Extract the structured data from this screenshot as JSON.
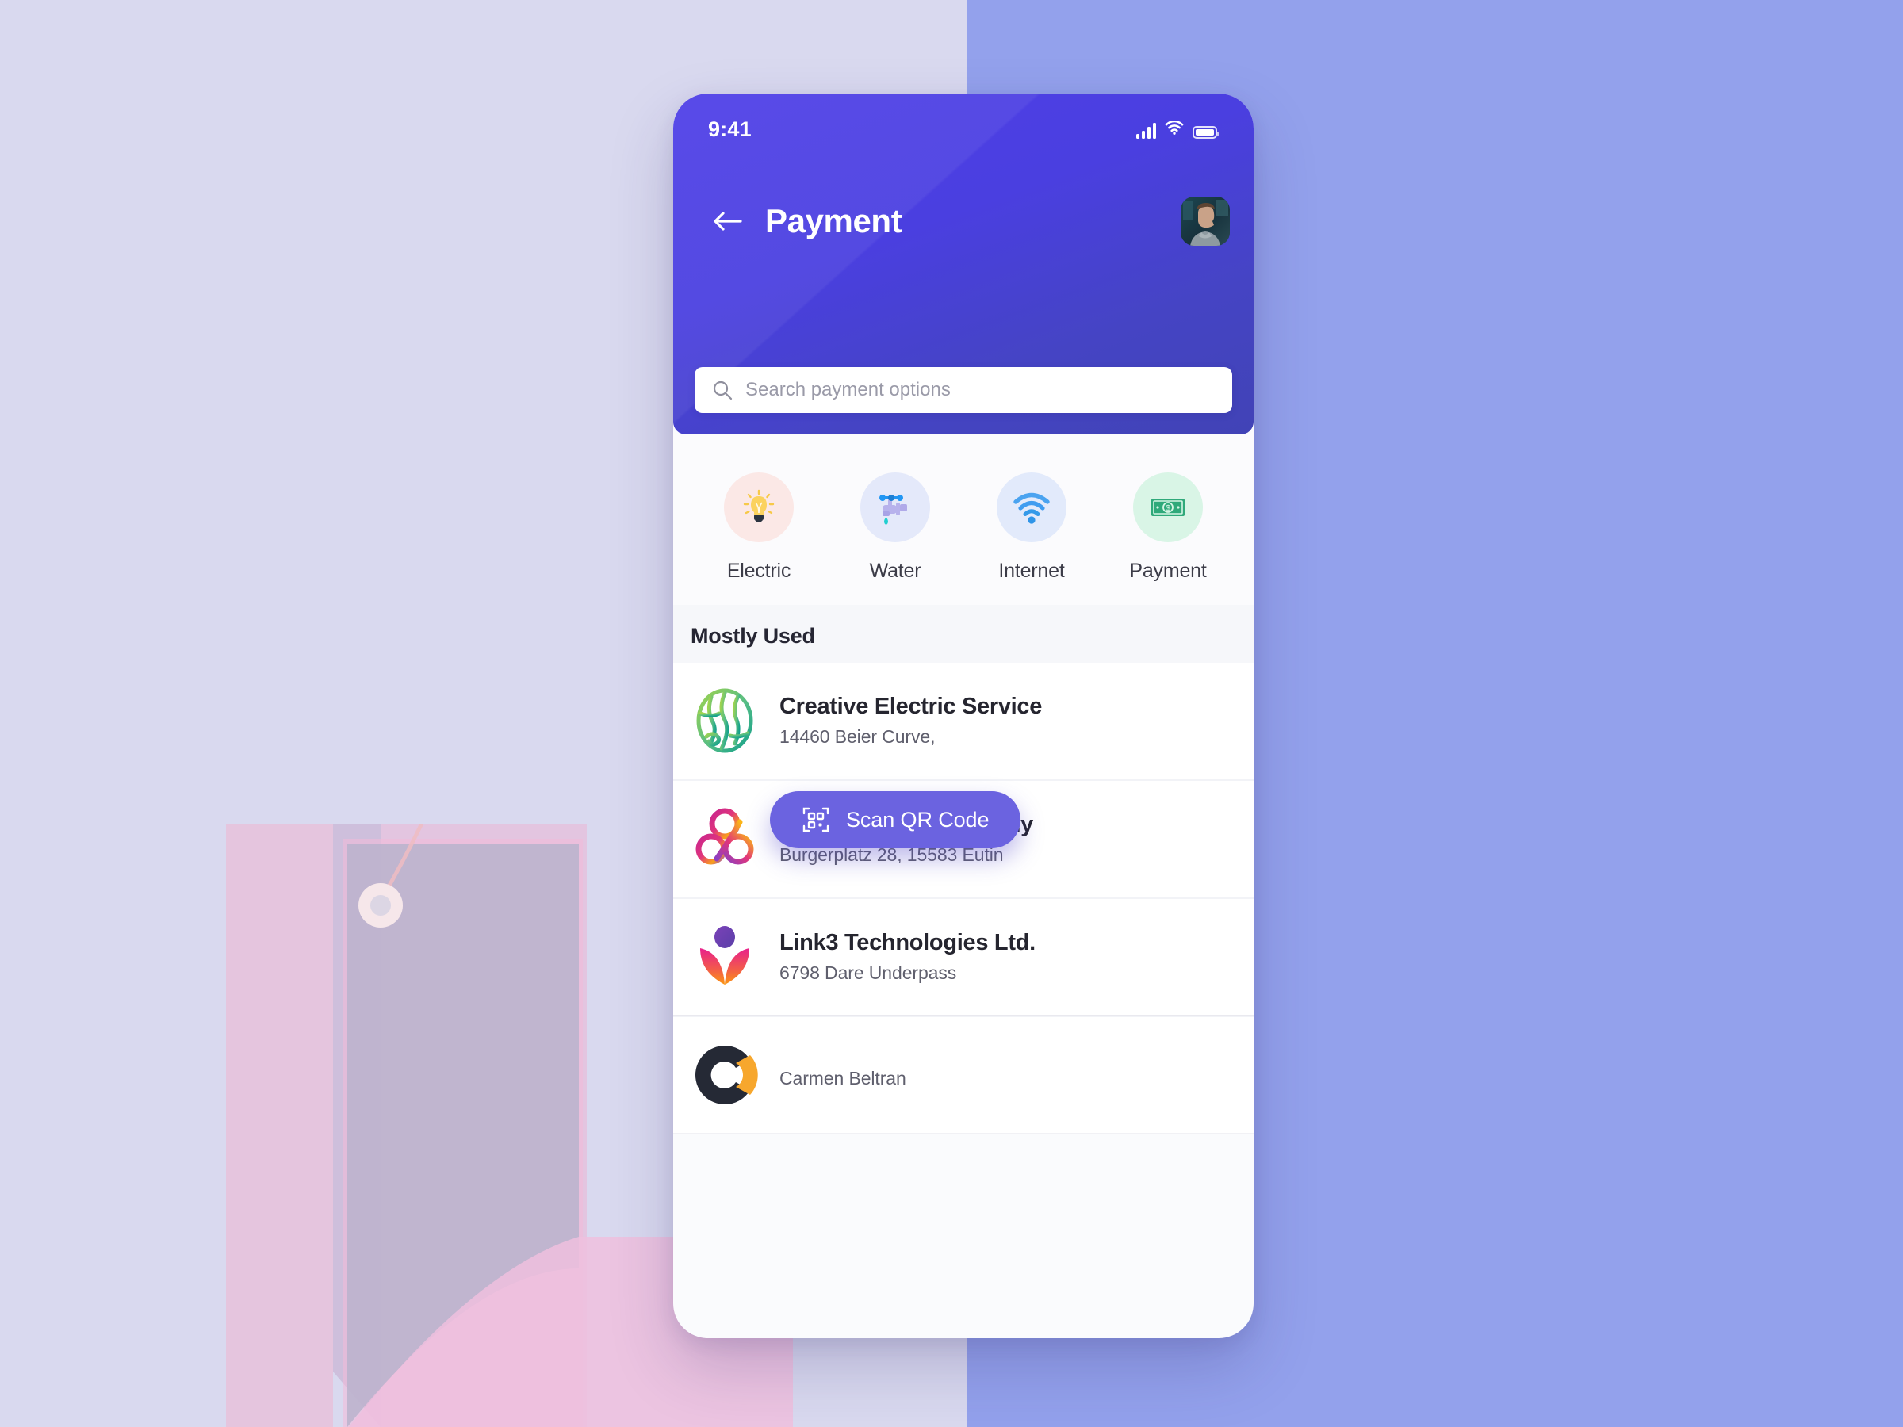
{
  "background": {
    "left_color": "#d9d9ef",
    "right_color": "#93a1ec",
    "illustration": "shopping-bag-with-price-tag"
  },
  "phone": {
    "status_bar": {
      "time": "9:41",
      "icons": [
        "cellular-signal-icon",
        "wifi-icon",
        "battery-icon"
      ]
    },
    "header": {
      "accent_color": "#4a3fe0",
      "back_icon": "arrow-left-icon",
      "title": "Payment",
      "avatar_alt": "user-avatar"
    },
    "search": {
      "icon": "search-icon",
      "placeholder": "Search payment options",
      "value": ""
    },
    "categories": [
      {
        "label": "Electric",
        "icon": "lightbulb-icon",
        "bg": "#fbe8e6"
      },
      {
        "label": "Water",
        "icon": "faucet-icon",
        "bg": "#e4e9fa"
      },
      {
        "label": "Internet",
        "icon": "wifi-icon",
        "bg": "#e2eafb"
      },
      {
        "label": "Payment",
        "icon": "banknote-icon",
        "bg": "#d9f5e6"
      }
    ],
    "section": {
      "title": "Mostly Used"
    },
    "list": [
      {
        "logo": "green-globe-lines-logo",
        "title": "Creative Electric Service",
        "subtitle": "14460 Beier Curve,"
      },
      {
        "logo": "pink-trefoil-knot-logo",
        "title": "Pyhton Water Company",
        "subtitle": "Burgerplatz 28, 15583 Eutin"
      },
      {
        "logo": "purple-pink-lotus-logo",
        "title": "Link3 Technologies Ltd.",
        "subtitle": "6798 Dare Underpass"
      },
      {
        "logo": "dark-orange-ring-logo",
        "title": "",
        "subtitle": "Carmen Beltran"
      }
    ],
    "scan_button": {
      "icon": "qr-code-icon",
      "label": "Scan QR Code",
      "color": "#6b63e0"
    }
  }
}
